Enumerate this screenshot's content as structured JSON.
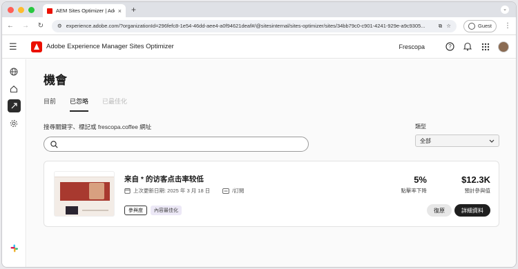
{
  "browser": {
    "tab_title": "AEM Sites Optimizer | Adob",
    "tab_close": "×",
    "new_tab": "+",
    "url": "experience.adobe.com/?organizationId=296fefc8-1e54-46dd-aee4-a0f94621deaf#/@sitesinternal/sites-optimizer/sites/34bb79c0-c901-4241-929e-a9c9305...",
    "guest_label": "Guest"
  },
  "header": {
    "app_name": "Adobe Experience Manager Sites Optimizer",
    "org_name": "Frescopa"
  },
  "page": {
    "title": "機會",
    "tabs": [
      {
        "label": "目前"
      },
      {
        "label": "已忽略"
      },
      {
        "label": "已最佳化"
      }
    ],
    "search_label": "搜尋關鍵字、標記或 frescopa.coffee 網址",
    "type_label": "類型",
    "type_value": "全部"
  },
  "card": {
    "title": "来自 * 的访客点击率较低",
    "updated": "上次更新日期: 2025 年 3 月 18 日",
    "channel": "/訂閱",
    "tags": [
      "參與度",
      "內容最佳化"
    ],
    "metric1_value": "5%",
    "metric1_label": "點擊率下降",
    "metric2_value": "$12.3K",
    "metric2_label": "預計參與值",
    "restore_label": "復原",
    "details_label": "詳細資料"
  },
  "colors": {
    "adobe_red": "#eb1000",
    "primary_button": "#1f1f1f"
  },
  "icons": [
    "back-icon",
    "forward-icon",
    "reload-icon",
    "menu-icon",
    "help-icon",
    "bell-icon",
    "apps-grid-icon",
    "globe-icon",
    "home-icon",
    "opportunities-icon",
    "settings-icon",
    "slack-icon",
    "search-icon",
    "calendar-icon",
    "page-icon",
    "chevron-down-icon"
  ]
}
